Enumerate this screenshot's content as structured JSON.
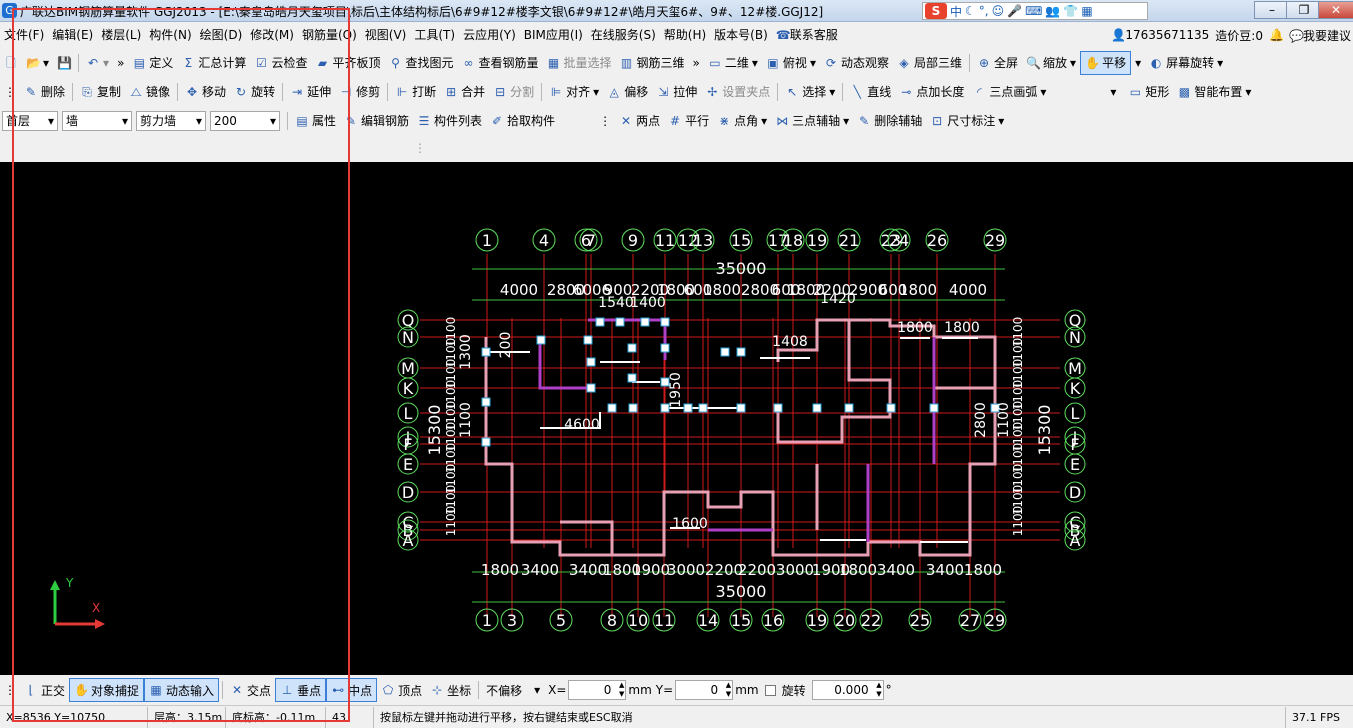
{
  "titlebar": {
    "title": "广联达BIM钢筋算量软件 GGJ2013 - [E:\\秦皇岛皓月天玺项目\\标后\\主体结构标后\\6#9#12#楼李文银\\6#9#12#\\皓月天玺6#、9#、12#楼.GGJ12]",
    "ime_logo": "S",
    "ime_label": "中"
  },
  "menu": {
    "items": [
      "文件(F)",
      "编辑(E)",
      "楼层(L)",
      "构件(N)",
      "绘图(D)",
      "修改(M)",
      "钢筋量(Q)",
      "视图(V)",
      "工具(T)",
      "云应用(Y)",
      "BIM应用(I)",
      "在线服务(S)",
      "帮助(H)",
      "版本号(B)",
      "联系客服"
    ],
    "user": "17635671135",
    "beans": "造价豆:0",
    "suggest": "我要建议"
  },
  "toolbar1": {
    "define": "定义",
    "calc": "汇总计算",
    "cloud_check": "云检查",
    "flat_slab": "平齐板顶",
    "find": "查找图元",
    "view_rebar": "查看钢筋量",
    "batch_select": "批量选择",
    "rebar_3d": "钢筋三维",
    "view_2d": "二维",
    "top_view": "俯视",
    "orbit": "动态观察",
    "local_3d": "局部三维",
    "fullscreen": "全屏",
    "zoom": "缩放",
    "pan": "平移",
    "rotate_screen": "屏幕旋转"
  },
  "toolbar2": {
    "delete": "删除",
    "copy": "复制",
    "mirror": "镜像",
    "move": "移动",
    "rotate": "旋转",
    "extend": "延伸",
    "trim": "修剪",
    "break": "打断",
    "merge": "合并",
    "split": "分割",
    "align": "对齐",
    "offset": "偏移",
    "stretch": "拉伸",
    "set_grip": "设置夹点",
    "select": "选择",
    "line": "直线",
    "point_len": "点加长度",
    "arc3": "三点画弧",
    "rect": "矩形",
    "smart_layout": "智能布置"
  },
  "toolbar3": {
    "floor": "首层",
    "category": "墙",
    "type": "剪力墙",
    "code": "200",
    "props": "属性",
    "edit_rebar": "编辑钢筋",
    "comp_list": "构件列表",
    "pick": "拾取构件",
    "two_pt": "两点",
    "parallel": "平行",
    "pt_angle": "点角",
    "aux3": "三点辅轴",
    "del_aux": "删除辅轴",
    "dim": "尺寸标注"
  },
  "drawing": {
    "top_axes": [
      "1",
      "4",
      "6",
      "7",
      "9",
      "11",
      "12",
      "13",
      "15",
      "17",
      "18",
      "19",
      "21",
      "23",
      "24",
      "26",
      "29"
    ],
    "bottom_axes": [
      "1",
      "3",
      "5",
      "8",
      "10",
      "11",
      "14",
      "15",
      "16",
      "19",
      "20",
      "22",
      "25",
      "27",
      "29"
    ],
    "left_axes": [
      "Q",
      "N",
      "M",
      "K",
      "L",
      "J",
      "F",
      "E",
      "D",
      "C",
      "B",
      "A"
    ],
    "top_total": "35000",
    "bottom_total": "35000",
    "left_total": "15300",
    "right_total": "15300",
    "top_dims": [
      "4000",
      "2800",
      "6006",
      "900",
      "2200",
      "1800",
      "600",
      "1800",
      "2800",
      "600",
      "1800",
      "2200",
      "2900",
      "600",
      "1800",
      "4000"
    ],
    "bottom_dims": [
      "1800",
      "3400",
      "3400",
      "1800",
      "1900",
      "3000",
      "2200",
      "2200",
      "3000",
      "1900",
      "1800",
      "3400",
      "3400",
      "1800"
    ],
    "inner_labels": [
      "1540",
      "1400",
      "1420",
      "1800",
      "1800",
      "1408",
      "4600",
      "2800",
      "1600",
      "1100",
      "1100",
      "1300",
      "200",
      "1950"
    ],
    "axis_y_label": "Y",
    "axis_x_label": "X"
  },
  "bottom": {
    "ortho": "正交",
    "snap": "对象捕捉",
    "dyn_input": "动态输入",
    "intersect": "交点",
    "perp": "垂点",
    "mid": "中点",
    "vertex": "顶点",
    "coord": "坐标",
    "offset_mode": "不偏移",
    "x_label": "X=",
    "x_val": "0",
    "mm1": "mm",
    "y_label": "Y=",
    "y_val": "0",
    "mm2": "mm",
    "rotate_label": "旋转",
    "rotate_val": "0.000",
    "deg": "°"
  },
  "status": {
    "coords": "X=8536  Y=10750",
    "floor_h": "层高：3.15m",
    "base_h": "底标高：-0.11m",
    "num": "43",
    "hint": "按鼠标左键并拖动进行平移，按右键结束或ESC取消",
    "fps": "37.1 FPS"
  },
  "colors": {
    "grid": "#d11a1a",
    "wall": "#ffffff",
    "dim": "#ffffff",
    "axis_circle": "#5fe05f",
    "highlight": "#e53935"
  }
}
